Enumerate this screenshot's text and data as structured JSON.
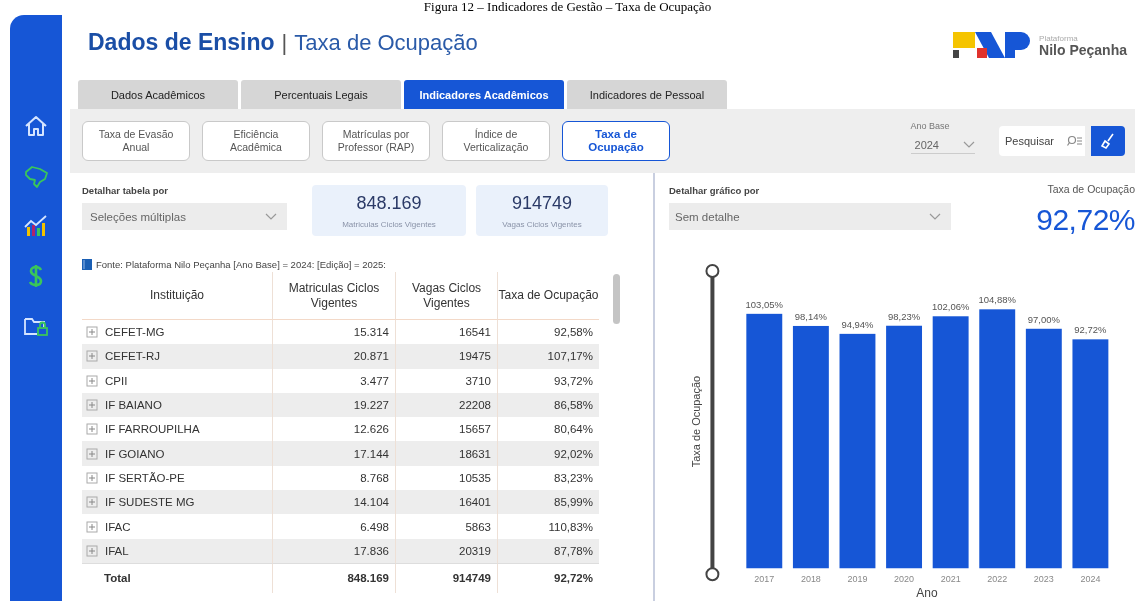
{
  "caption": "Figura 12 – Indicadores de Gestão – Taxa de Ocupação",
  "header": {
    "title": "Dados de Ensino",
    "separator": "|",
    "subtitle": "Taxa de Ocupação",
    "logo": {
      "small": "Plataforma",
      "name": "Nilo Peçanha"
    }
  },
  "tabs": [
    {
      "label": "Dados Acadêmicos",
      "selected": false
    },
    {
      "label": "Percentuais Legais",
      "selected": false
    },
    {
      "label": "Indicadores Acadêmicos",
      "selected": true
    },
    {
      "label": "Indicadores de Pessoal",
      "selected": false
    }
  ],
  "subtabs": [
    {
      "label": "Taxa de Evasão\nAnual",
      "selected": false
    },
    {
      "label": "Eficiência\nAcadêmica",
      "selected": false
    },
    {
      "label": "Matrículas por\nProfessor (RAP)",
      "selected": false
    },
    {
      "label": "Índice de\nVerticalização",
      "selected": false
    },
    {
      "label": "Taxa de\nOcupação",
      "selected": true
    }
  ],
  "ano_base": {
    "label": "Ano Base",
    "value": "2024"
  },
  "search": {
    "placeholder": "Pesquisar"
  },
  "table_panel": {
    "detail": {
      "label": "Detalhar tabela por",
      "value": "Seleções múltiplas"
    },
    "kpis": [
      {
        "value": "848.169",
        "label": "Matriculas Ciclos Vigentes"
      },
      {
        "value": "914749",
        "label": "Vagas Ciclos Vigentes"
      }
    ],
    "source": "Fonte: Plataforma Nilo Peçanha [Ano Base] = 2024: [Edição] = 2025:",
    "table": {
      "columns": [
        "Instituição",
        "Matriculas Ciclos Vigentes",
        "Vagas Ciclos Vigentes",
        "Taxa de Ocupação"
      ],
      "rows": [
        {
          "cells": [
            "CEFET-MG",
            "15.314",
            "16541",
            "92,58%"
          ],
          "expanded": false
        },
        {
          "cells": [
            "CEFET-RJ",
            "20.871",
            "19475",
            "107,17%"
          ],
          "expanded": false
        },
        {
          "cells": [
            "CPII",
            "3.477",
            "3710",
            "93,72%"
          ],
          "expanded": false
        },
        {
          "cells": [
            "IF BAIANO",
            "19.227",
            "22208",
            "86,58%"
          ],
          "expanded": false
        },
        {
          "cells": [
            "IF FARROUPILHA",
            "12.626",
            "15657",
            "80,64%"
          ],
          "expanded": false
        },
        {
          "cells": [
            "IF GOIANO",
            "17.144",
            "18631",
            "92,02%"
          ],
          "expanded": false
        },
        {
          "cells": [
            "IF SERTÃO-PE",
            "8.768",
            "10535",
            "83,23%"
          ],
          "expanded": false
        },
        {
          "cells": [
            "IF SUDESTE MG",
            "14.104",
            "16401",
            "85,99%"
          ],
          "expanded": false
        },
        {
          "cells": [
            "IFAC",
            "6.498",
            "5863",
            "110,83%"
          ],
          "expanded": false
        },
        {
          "cells": [
            "IFAL",
            "17.836",
            "20319",
            "87,78%"
          ],
          "expanded": false
        }
      ],
      "total": [
        "Total",
        "848.169",
        "914749",
        "92,72%"
      ]
    }
  },
  "chart_panel": {
    "detail": {
      "label": "Detalhar gráfico por",
      "value": "Sem detalhe"
    },
    "kpi": {
      "label": "Taxa de Ocupação",
      "value": "92,72%"
    },
    "chart_data": {
      "type": "bar",
      "xlabel": "Ano",
      "ylabel": "Taxa de Ocupação",
      "categories": [
        "2017",
        "2018",
        "2019",
        "2020",
        "2021",
        "2022",
        "2023",
        "2024"
      ],
      "values": [
        103.05,
        98.14,
        94.94,
        98.23,
        102.06,
        104.88,
        97.0,
        92.72
      ],
      "value_labels": [
        "103,05%",
        "98,14%",
        "94,94%",
        "98,23%",
        "102,06%",
        "104,88%",
        "97,00%",
        "92,72%"
      ]
    }
  }
}
